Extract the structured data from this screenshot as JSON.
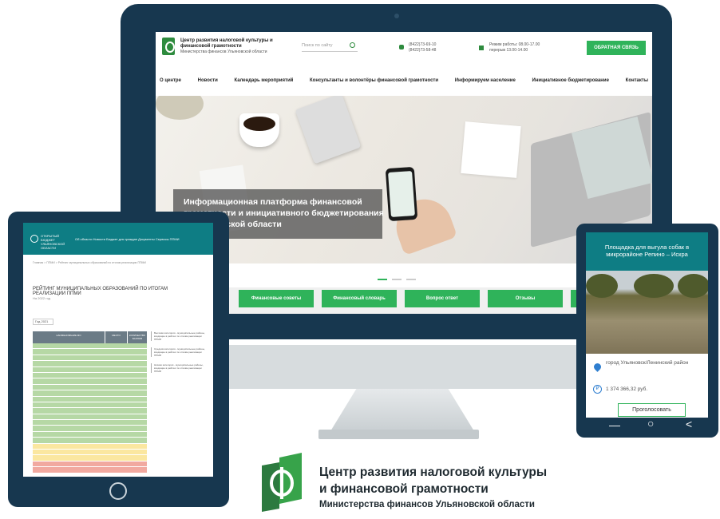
{
  "site": {
    "title": "Центр развития налоговой культуры и финансовой грамотности",
    "subtitle": "Министерства финансов Ульяновской области",
    "search_placeholder": "Поиск по сайту",
    "phones": "(8422)73-69-10\n(8422)73-58-48",
    "hours": "Режим работы: 08.00-17.00\nперерыв 13.00-14.00",
    "feedback_label": "ОБРАТНАЯ СВЯЗЬ",
    "nav": [
      "О центре",
      "Новости",
      "Календарь мероприятий",
      "Консультанты и волонтёры финансовой грамотности",
      "Информируем население",
      "Инициативное бюджетирование",
      "Контакты"
    ],
    "hero_caption": "Информационная платформа финансовой грамотности и инициативного бюджетирования в Ульяновской области",
    "buttons": [
      "Финансовые советы",
      "Финансовый словарь",
      "Вопрос ответ",
      "Отзывы"
    ]
  },
  "tablet": {
    "site_title": "ОТКРЫТЫЙ БЮДЖЕТ УЛЬЯНОВСКОЙ ОБЛАСТИ",
    "nav": "Об области  Новости  Бюджет для граждан  Документы  Сервисы  ППМИ",
    "breadcrumb": "Главная  >  ППМИ  >  Рейтинг муниципальных образований по итогам реализации ППМИ",
    "heading": "РЕЙТИНГ МУНИЦИПАЛЬНЫХ ОБРАЗОВАНИЙ ПО ИТОГАМ РЕАЛИЗАЦИИ ППМИ",
    "subheading": "На 2022 год",
    "year_select": "Год 2021",
    "table_headers": [
      "НАИМЕНОВАНИЕ МО",
      "МЕСТО",
      "КОЛИЧЕСТВО БАЛЛОВ"
    ],
    "notes": [
      "Высокая категория - муниципальные районы, входящие в рейтинг по итогам реализации ППМИ",
      "Средняя категория - муниципальные районы, входящие в рейтинг по итогам реализации ППМИ",
      "Низкая категория - муниципальные районы, входящие в рейтинг по итогам реализации ППМИ"
    ]
  },
  "phone": {
    "title": "Площадка для выгула собак в микрорайоне Репино – Искра",
    "address": "город Ульяновск/Ленинский район",
    "price": "1 374 366,32 руб.",
    "vote_label": "Проголосовать",
    "nav_back": "<",
    "nav_home": "○",
    "nav_menu": "—"
  },
  "footer_logo": {
    "line1": "Центр развития налоговой культуры",
    "line2": "и финансовой грамотности",
    "line3": "Министерства финансов Ульяновской области"
  },
  "colors": {
    "device": "#17374f",
    "accent_green": "#2fb35a",
    "teal": "#0e7d84",
    "row_green": "#b6d8a5",
    "row_yellow": "#fbe7a0",
    "row_red": "#f1a9a0"
  }
}
